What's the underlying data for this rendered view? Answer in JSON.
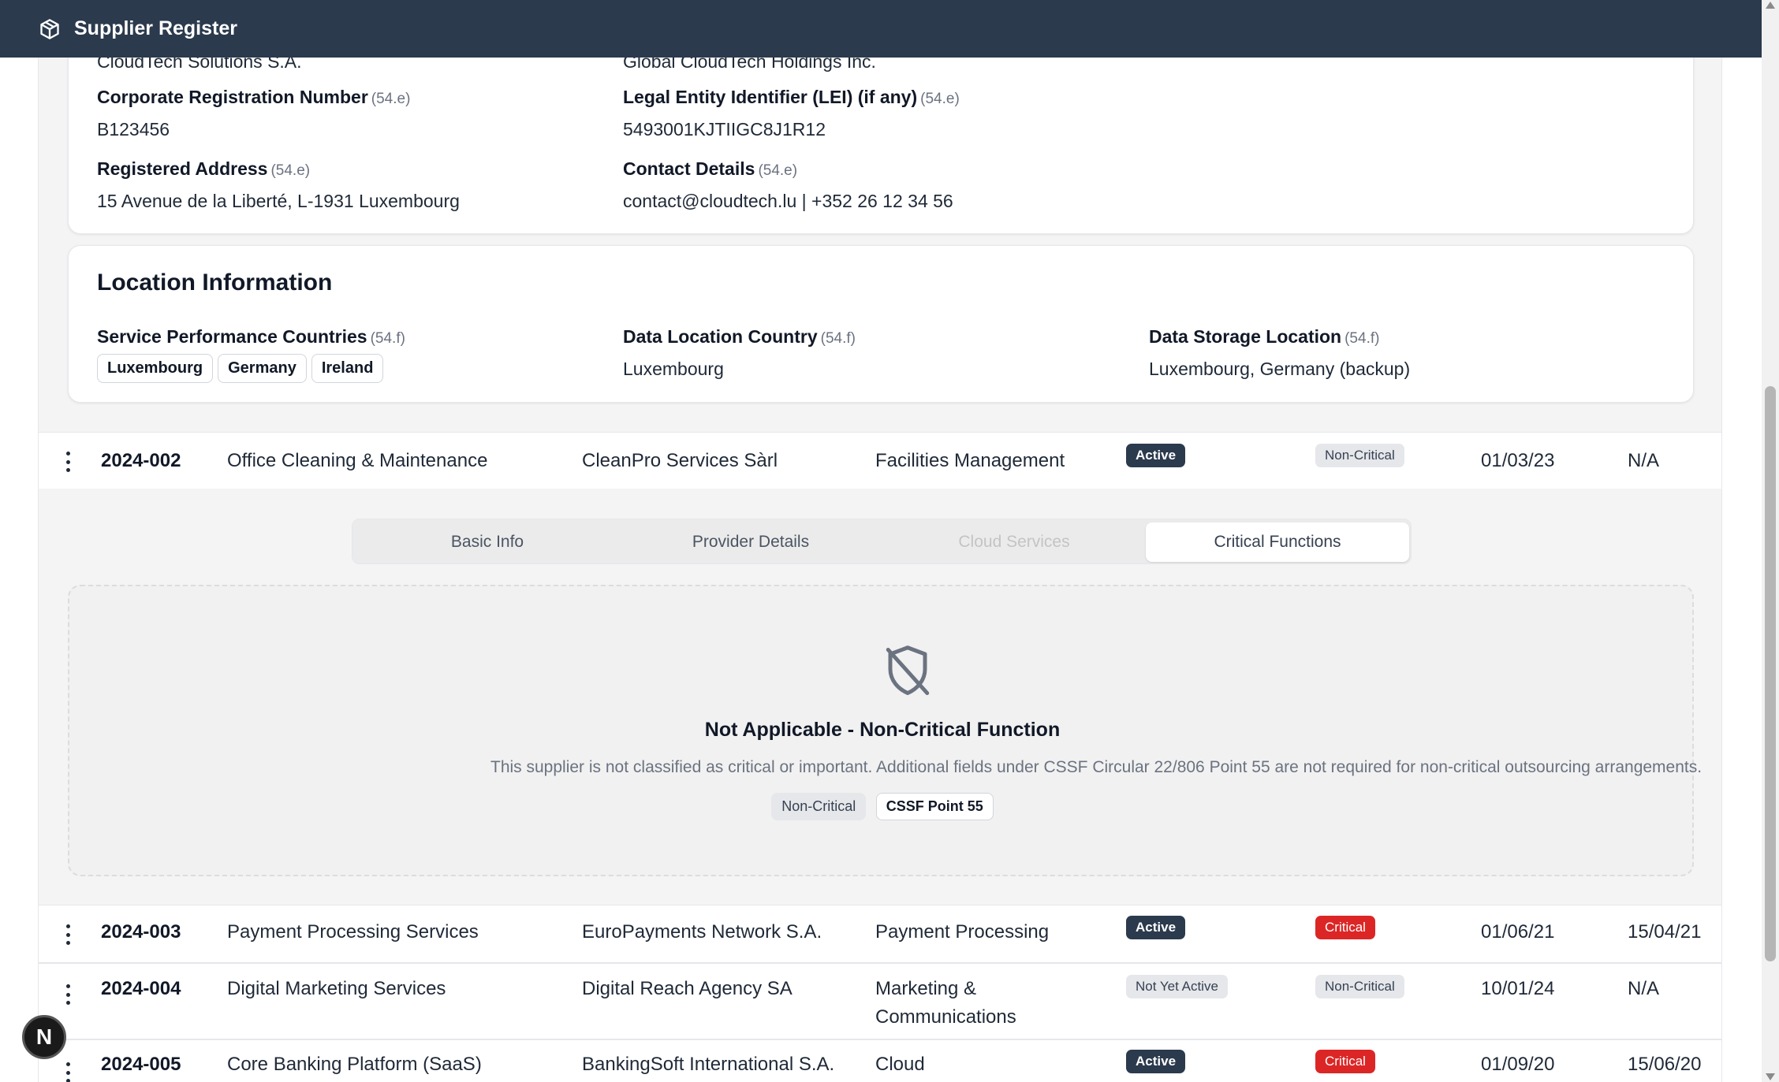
{
  "app": {
    "title": "Supplier Register"
  },
  "provider_card": {
    "row0": {
      "left_value": "CloudTech Solutions S.A.",
      "right_value": "Global CloudTech Holdings Inc."
    },
    "corp_reg": {
      "label": "Corporate Registration Number",
      "ref": "(54.e)",
      "value": "B123456"
    },
    "lei": {
      "label": "Legal Entity Identifier (LEI) (if any)",
      "ref": "(54.e)",
      "value": "5493001KJTIIGC8J1R12"
    },
    "address": {
      "label": "Registered Address",
      "ref": "(54.e)",
      "value": "15 Avenue de la Liberté, L-1931 Luxembourg"
    },
    "contact": {
      "label": "Contact Details",
      "ref": "(54.e)",
      "value": "contact@cloudtech.lu | +352 26 12 34 56"
    }
  },
  "location_card": {
    "title": "Location Information",
    "service_countries": {
      "label": "Service Performance Countries",
      "ref": "(54.f)",
      "chips": [
        "Luxembourg",
        "Germany",
        "Ireland"
      ]
    },
    "data_location": {
      "label": "Data Location Country",
      "ref": "(54.f)",
      "value": "Luxembourg"
    },
    "data_storage": {
      "label": "Data Storage Location",
      "ref": "(54.f)",
      "value": "Luxembourg, Germany (backup)"
    }
  },
  "rows": [
    {
      "id": "2024-002",
      "service": "Office Cleaning & Maintenance",
      "provider": "CleanPro Services Sàrl",
      "category": "Facilities Management",
      "status": "Active",
      "criticality": "Non-Critical",
      "start": "01/03/23",
      "assessed": "N/A"
    },
    {
      "id": "2024-003",
      "service": "Payment Processing Services",
      "provider": "EuroPayments Network S.A.",
      "category": "Payment Processing",
      "status": "Active",
      "criticality": "Critical",
      "start": "01/06/21",
      "assessed": "15/04/21"
    },
    {
      "id": "2024-004",
      "service": "Digital Marketing Services",
      "provider": "Digital Reach Agency SA",
      "category_line1": "Marketing &",
      "category_line2": "Communications",
      "status": "Not Yet Active",
      "criticality": "Non-Critical",
      "start": "10/01/24",
      "assessed": "N/A"
    },
    {
      "id": "2024-005",
      "service": "Core Banking Platform (SaaS)",
      "provider": "BankingSoft International S.A.",
      "category": "Cloud",
      "status": "Active",
      "criticality": "Critical",
      "start": "01/09/20",
      "assessed": "15/06/20"
    }
  ],
  "tabs": [
    {
      "label": "Basic Info",
      "state": "default"
    },
    {
      "label": "Provider Details",
      "state": "default"
    },
    {
      "label": "Cloud Services",
      "state": "disabled"
    },
    {
      "label": "Critical Functions",
      "state": "selected"
    }
  ],
  "not_applicable": {
    "icon": "shield-off-icon",
    "title": "Not Applicable - Non-Critical Function",
    "description": "This supplier is not classified as critical or important. Additional fields under CSSF Circular 22/806 Point 55 are not required for non-critical outsourcing arrangements.",
    "chips": [
      "Non-Critical",
      "CSSF Point 55"
    ]
  },
  "floating_button": {
    "label": "N"
  },
  "colors": {
    "topbar": "#2b3a4d",
    "active_badge": "#2b3a4d",
    "critical_badge": "#dc2626"
  }
}
